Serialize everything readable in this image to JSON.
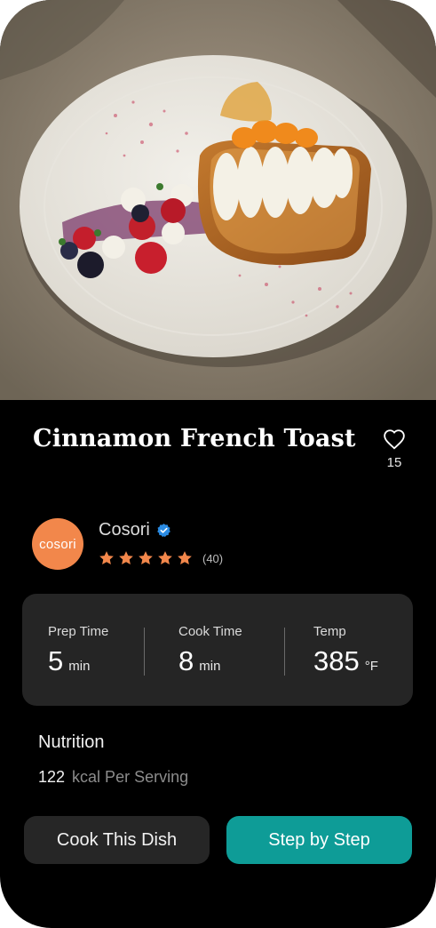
{
  "recipe": {
    "title": "Cinnamon French Toast",
    "likes": "15"
  },
  "author": {
    "name": "Cosori",
    "avatar_text": "cosori",
    "verified": true,
    "rating": 5,
    "rating_count": "(40)"
  },
  "stats": [
    {
      "label": "Prep Time",
      "value": "5",
      "unit": "min"
    },
    {
      "label": "Cook Time",
      "value": "8",
      "unit": "min"
    },
    {
      "label": "Temp",
      "value": "385",
      "unit": "°F"
    }
  ],
  "nutrition": {
    "title": "Nutrition",
    "kcal": "122",
    "kcal_label": "kcal Per Serving"
  },
  "buttons": {
    "cook": "Cook This Dish",
    "step": "Step by Step"
  },
  "colors": {
    "accent": "#0e9c97",
    "avatar": "#f2874b",
    "star": "#f2874b",
    "verified": "#2a8be3",
    "card": "#252525"
  },
  "icons": {
    "like": "heart-outline-icon",
    "verified": "verified-badge-icon",
    "star": "star-filled-icon"
  }
}
